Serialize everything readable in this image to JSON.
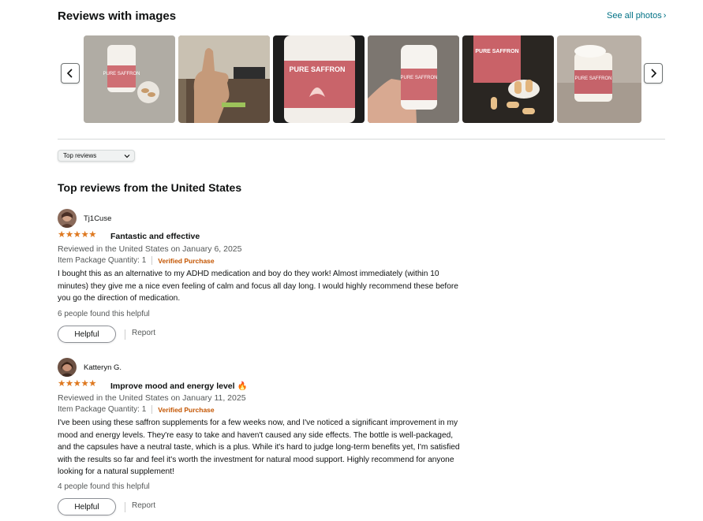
{
  "gallery": {
    "title": "Reviews with images",
    "see_all": "See all photos",
    "prev_icon": "chevron-left-icon",
    "next_icon": "chevron-right-icon"
  },
  "sort": {
    "selected": "Top reviews"
  },
  "reviews_section": {
    "title": "Top reviews from the United States"
  },
  "reviews": [
    {
      "reviewer": "Tj1Cuse",
      "rating": 5,
      "title": "Fantastic and effective",
      "date": "Reviewed in the United States on January 6, 2025",
      "package": "Item Package Quantity: 1",
      "verified": "Verified Purchase",
      "body": "I bought this as an alternative to my ADHD medication and boy do they work! Almost immediately (within 10 minutes) they give me a nice even feeling of calm and focus all day long. I would highly recommend these before you go the direction of medication.",
      "helpful_count": "6 people found this helpful",
      "helpful_label": "Helpful",
      "report_label": "Report"
    },
    {
      "reviewer": "Katteryn G.",
      "rating": 5,
      "title": "Improve mood and energy level",
      "title_emoji": "🔥",
      "date": "Reviewed in the United States on January 11, 2025",
      "package": "Item Package Quantity: 1",
      "verified": "Verified Purchase",
      "body": "I've been using these saffron supplements for a few weeks now, and I've noticed a significant improvement in my mood and energy levels. They're easy to take and haven't caused any side effects. The bottle is well-packaged, and the capsules have a neutral taste, which is a plus. While it's hard to judge long-term benefits yet, I'm satisfied with the results so far and feel it's worth the investment for natural mood support. Highly recommend for anyone looking for a natural supplement!",
      "helpful_count": "4 people found this helpful",
      "helpful_label": "Helpful",
      "report_label": "Report"
    }
  ],
  "colors": {
    "link": "#007185",
    "star": "#de7921",
    "verified": "#c45500",
    "muted": "#565959"
  }
}
